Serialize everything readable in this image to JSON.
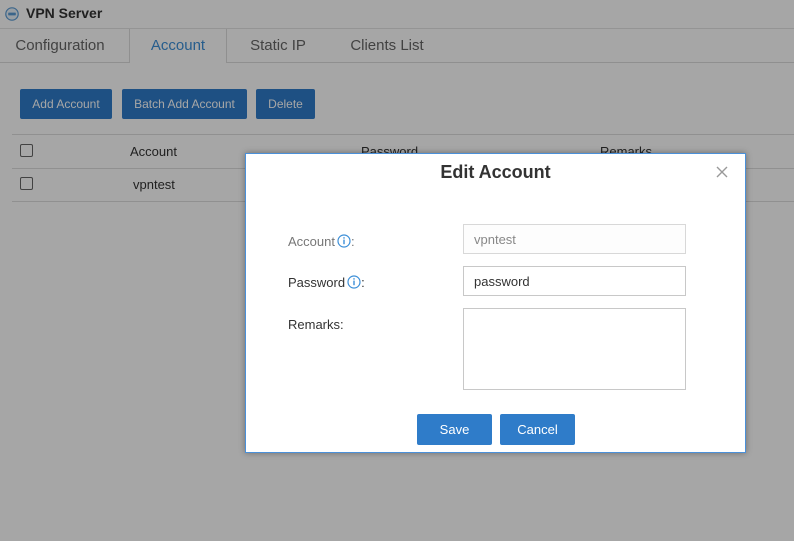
{
  "app": {
    "title": "VPN Server",
    "icon": "vpn-server-icon"
  },
  "tabs": [
    {
      "label": "Configuration",
      "active": false
    },
    {
      "label": "Account",
      "active": true
    },
    {
      "label": "Static IP",
      "active": false
    },
    {
      "label": "Clients List",
      "active": false
    }
  ],
  "toolbar": {
    "add_account": "Add Account",
    "batch_add_account": "Batch Add Account",
    "delete": "Delete"
  },
  "table": {
    "headers": [
      "Account",
      "Password",
      "Remarks"
    ],
    "rows": [
      {
        "account": "vpntest"
      }
    ]
  },
  "dialog": {
    "title": "Edit Account",
    "account_label": "Account",
    "account_value": "vpntest",
    "password_label": "Password",
    "password_value": "password",
    "remarks_label": "Remarks:",
    "remarks_value": "",
    "colon": ":",
    "save": "Save",
    "cancel": "Cancel"
  },
  "colors": {
    "accent": "#2f7cc9",
    "info_icon": "#3c8fd8",
    "overlay": "rgba(0,0,0,0.35)"
  }
}
